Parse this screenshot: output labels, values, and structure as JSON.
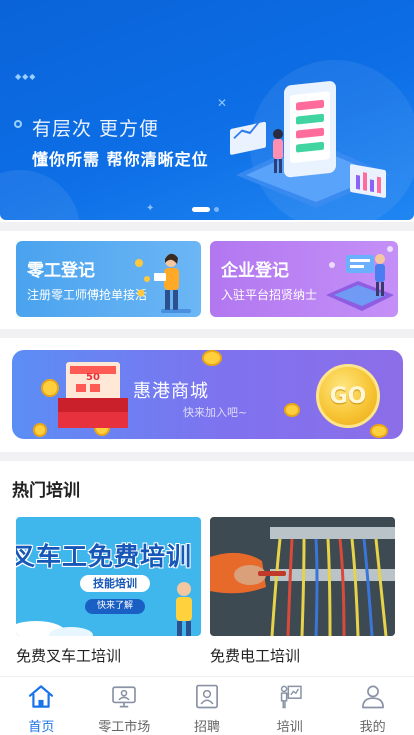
{
  "hero": {
    "line1": "有层次 更方便",
    "line2": "懂你所需 帮你清晰定位",
    "slides_total": 2,
    "slide_active": 1
  },
  "registration": [
    {
      "title": "零工登记",
      "subtitle": "注册零工师傅抢单接活",
      "color": "#5aaaf0"
    },
    {
      "title": "企业登记",
      "subtitle": "入驻平台招贤纳士",
      "color": "#b983f4"
    }
  ],
  "mall": {
    "title": "惠港商城",
    "subtitle": "快来加入吧~",
    "go_label": "GO",
    "coupon_value": "50"
  },
  "training": {
    "section_title": "热门培训",
    "courses": [
      {
        "title": "免费叉车工培训",
        "banner_text": "叉车工免费培训",
        "tag": "技能培训",
        "button": "快来了解"
      },
      {
        "title": "免费电工培训"
      }
    ]
  },
  "tabbar": {
    "active_color": "#1a73e8",
    "items": [
      {
        "label": "首页",
        "icon": "home-icon",
        "active": true
      },
      {
        "label": "零工市场",
        "icon": "monitor-icon",
        "active": false
      },
      {
        "label": "招聘",
        "icon": "portrait-icon",
        "active": false
      },
      {
        "label": "培训",
        "icon": "presentation-icon",
        "active": false
      },
      {
        "label": "我的",
        "icon": "user-icon",
        "active": false
      }
    ]
  }
}
